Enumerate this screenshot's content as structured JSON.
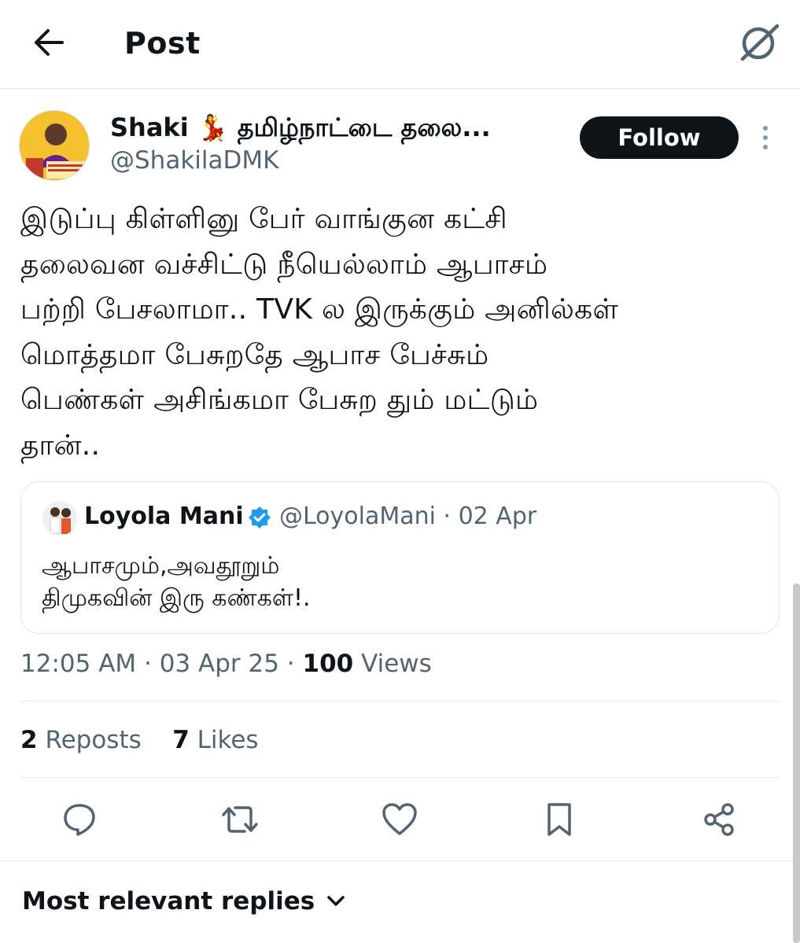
{
  "header": {
    "title": "Post",
    "back_icon": "arrow-left-icon",
    "grok_icon": "grok-icon"
  },
  "post": {
    "display_name": "Shaki 💃 தமிழ்நாட்டை தலை...",
    "handle": "@ShakilaDMK",
    "follow_label": "Follow",
    "text": "இடுப்பு கிள்ளினு பேர் வாங்குன கட்சி\nதலைவன வச்சிட்டு நீயெல்லாம் ஆபாசம்\nபற்றி பேசலாமா.. TVK ல இருக்கும் அனில்கள்\nமொத்தமா பேசுறதே ஆபாச பேச்சும்\nபெண்கள் அசிங்கமா பேசுற தும் மட்டும்\nதான்..",
    "time": "12:05 AM · 03 Apr 25 · ",
    "views_count": "100",
    "views_label": " Views",
    "reposts_count": "2",
    "reposts_label": "Reposts",
    "likes_count": "7",
    "likes_label": "Likes"
  },
  "quote": {
    "name": "Loyola Mani",
    "handle_date": "@LoyolaMani · 02 Apr",
    "line1": "ஆபாசமும்,அவதூறும்",
    "line2": "திமுகவின் இரு கண்கள்!."
  },
  "actions": [
    "reply-icon",
    "repost-icon",
    "like-icon",
    "bookmark-icon",
    "share-icon"
  ],
  "replies": {
    "sort_label": "Most relevant replies"
  },
  "colors": {
    "text": "#0f1419",
    "secondary": "#536471",
    "verified": "#1d9bf0",
    "divider": "#e6e9ec"
  }
}
